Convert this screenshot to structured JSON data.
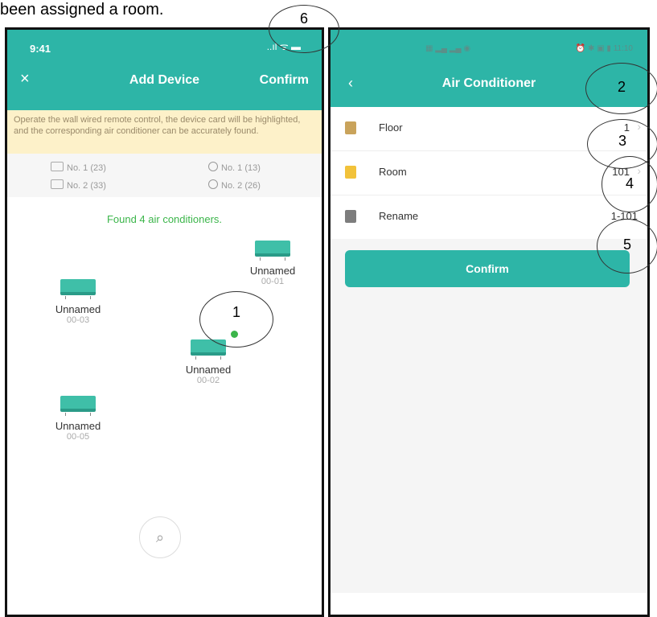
{
  "caption": "been assigned a room.",
  "left": {
    "status_time": "9:41",
    "status_icons": "..ıl ᯤ ▬",
    "close_icon": "×",
    "title": "Add Device",
    "confirm": "Confirm",
    "banner": "Operate the wall wired remote control, the device card will be highlighted, and the corresponding air conditioner can be accurately found.",
    "stats": [
      {
        "text": "No. 1 (23)",
        "icon": "remote-icon"
      },
      {
        "text": "No. 1 (13)",
        "icon": "clock-icon"
      },
      {
        "text": "No. 2 (33)",
        "icon": "remote-icon"
      },
      {
        "text": "No. 2 (26)",
        "icon": "clock-icon"
      }
    ],
    "found": "Found 4 air conditioners.",
    "devices": [
      {
        "name": "Unnamed",
        "code": "00-01"
      },
      {
        "name": "Unnamed",
        "code": "00-03"
      },
      {
        "name": "Unnamed",
        "code": "00-02"
      },
      {
        "name": "Unnamed",
        "code": "00-05"
      }
    ],
    "search_icon": "⌕"
  },
  "right": {
    "status_left": "▦ ▂▄ ▂▄ ◉",
    "status_right": "⏰ ✱ ▣ ▮ 11:10",
    "back": "‹",
    "title": "Air Conditioner",
    "rows": [
      {
        "label": "Floor",
        "value": "1",
        "chevron": "›",
        "icon_color": "#c9a35b"
      },
      {
        "label": "Room",
        "value": "101",
        "chevron": "›",
        "icon_color": "#f2c23a"
      },
      {
        "label": "Rename",
        "value": "1-101",
        "icon_color": "#7d7d7d"
      }
    ],
    "confirm": "Confirm"
  },
  "callouts": [
    "1",
    "2",
    "3",
    "4",
    "5",
    "6"
  ],
  "colors": {
    "accent": "#2db5a7",
    "found": "#3bb54a",
    "banner": "#fdf1c9"
  }
}
